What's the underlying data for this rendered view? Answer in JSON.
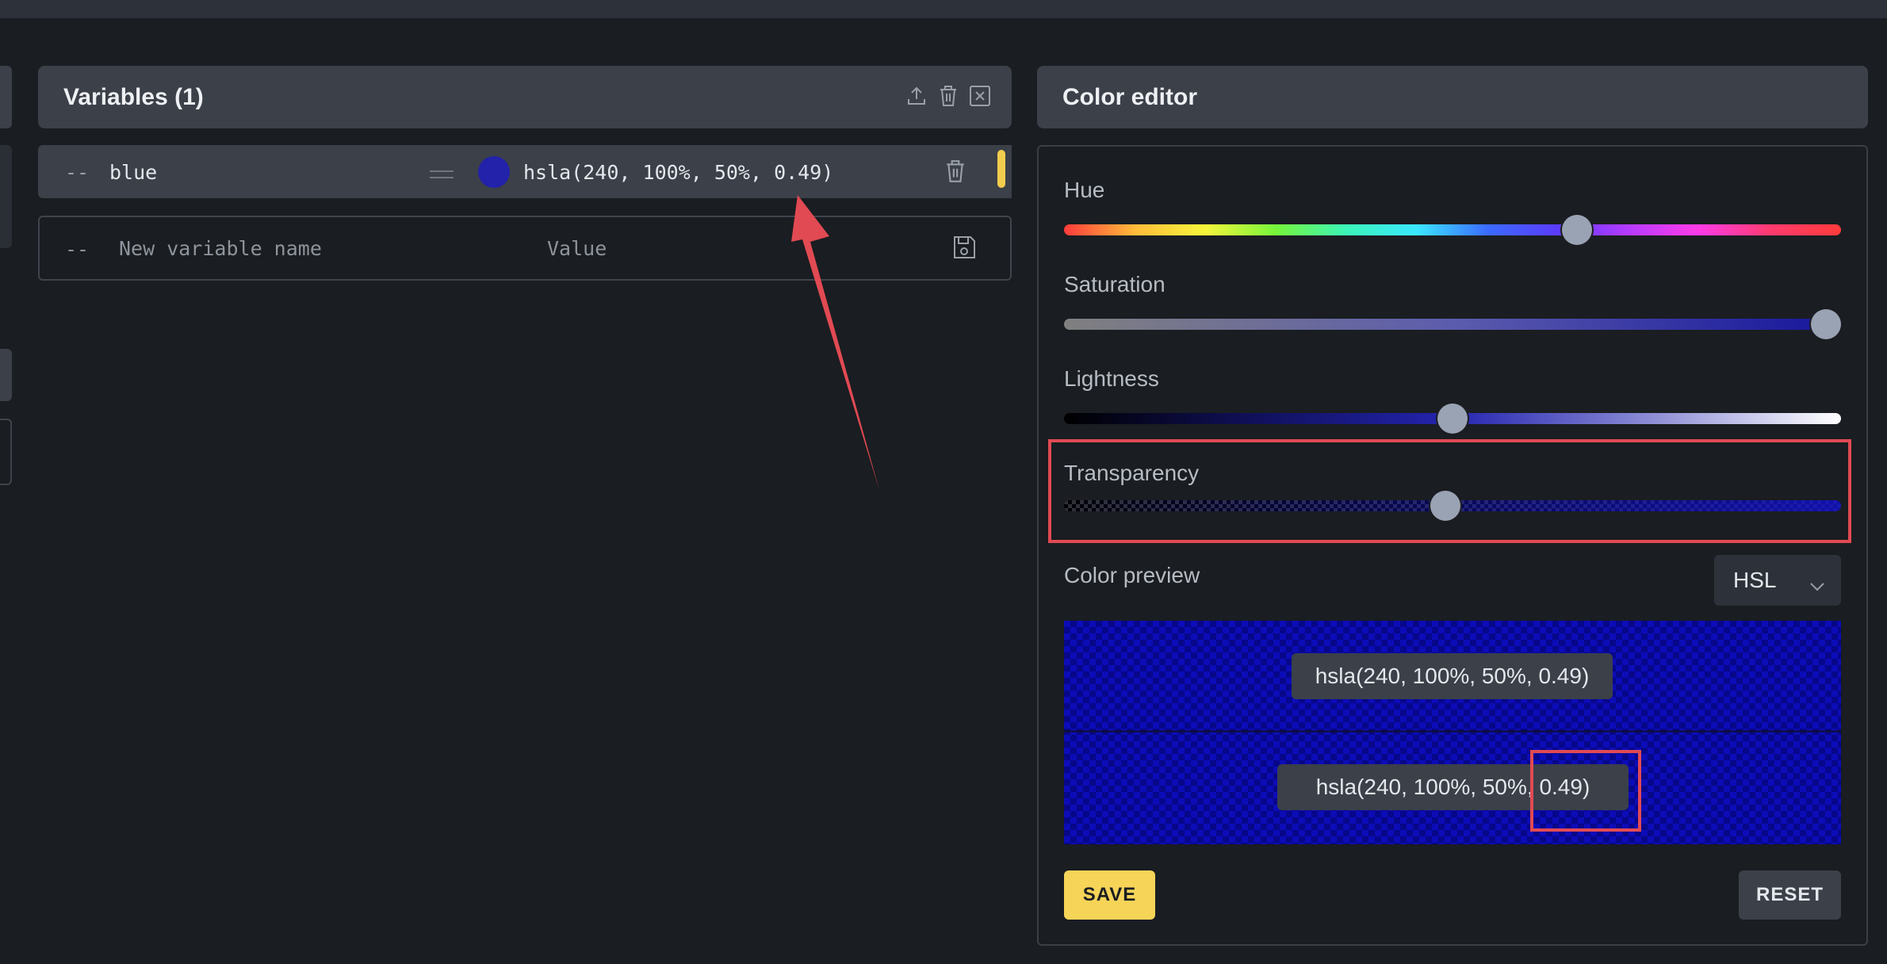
{
  "variables_panel": {
    "title": "Variables (1)",
    "rows": [
      {
        "prefix": "--",
        "name": "blue",
        "value": "hsla(240, 100%, 50%, 0.49)",
        "swatch_color": "#2222aa"
      }
    ],
    "new_row": {
      "prefix": "--",
      "name_placeholder": "New variable name",
      "value_placeholder": "Value"
    }
  },
  "color_editor": {
    "title": "Color editor",
    "sliders": {
      "hue": {
        "label": "Hue",
        "value": 240,
        "max": 360
      },
      "saturation": {
        "label": "Saturation",
        "value": 100,
        "max": 100
      },
      "lightness": {
        "label": "Lightness",
        "value": 50,
        "max": 100
      },
      "transparency": {
        "label": "Transparency",
        "value": 0.49,
        "max": 1
      }
    },
    "preview": {
      "label": "Color preview",
      "format": "HSL",
      "original_value": "hsla(240, 100%, 50%, 0.49)",
      "new_value": "hsla(240, 100%, 50%, 0.49)"
    },
    "save_label": "SAVE",
    "reset_label": "RESET"
  },
  "colors": {
    "accent": "#f6d458",
    "highlight": "#e14a53",
    "panel": "#3b4049",
    "background": "#1a1d21"
  }
}
